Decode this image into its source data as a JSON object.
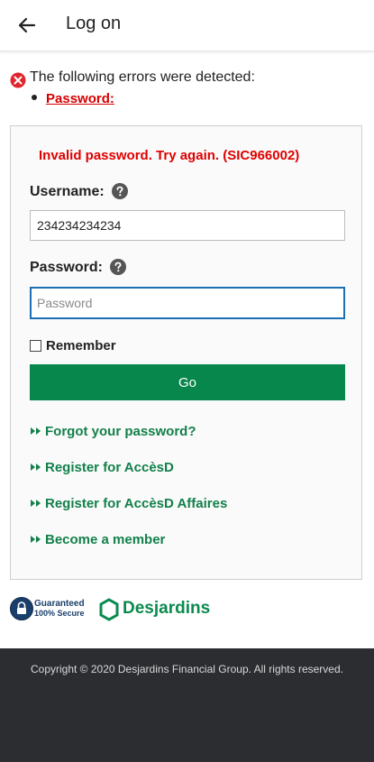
{
  "header": {
    "title": "Log on",
    "back_icon": "arrow-left-icon"
  },
  "errors": {
    "summary": "The following errors were detected:",
    "items": [
      "Password:"
    ],
    "icon": "error-x-icon"
  },
  "form": {
    "invalid_message": "Invalid password. Try again. (SIC966002)",
    "username_label": "Username:",
    "username_value": "234234234234",
    "password_label": "Password:",
    "password_placeholder": "Password",
    "remember_label": "Remember",
    "remember_checked": false,
    "go_label": "Go"
  },
  "links": [
    "Forgot your password?",
    "Register for AccèsD",
    "Register for AccèsD Affaires",
    "Become a member"
  ],
  "badges": {
    "secure_line1": "Guaranteed",
    "secure_line2": "100% Secure",
    "brand": "Desjardins"
  },
  "footer": {
    "copyright": "Copyright © 2020 Desjardins Financial Group. All rights reserved."
  },
  "colors": {
    "brand_green": "#08874c",
    "link_green": "#12804a",
    "error_red": "#e00000",
    "focus_blue": "#1c6fb5",
    "footer_bg": "#2b2d31"
  }
}
